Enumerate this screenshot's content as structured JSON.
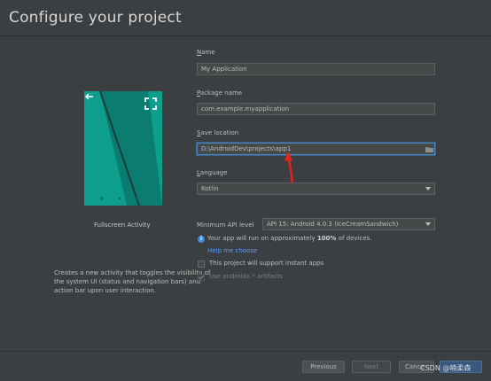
{
  "header": {
    "title": "Configure your project"
  },
  "preview": {
    "template_name": "Fullscreen Activity",
    "description": "Creates a new activity that toggles the visibility of the system UI (status and navigation bars) and action bar upon user interaction.",
    "phone_color": "#0e9e8d",
    "icons": [
      "back-arrow-icon",
      "fullscreen-icon"
    ]
  },
  "form": {
    "name": {
      "label_key": "N",
      "label_rest": "ame",
      "value": "My Application"
    },
    "package": {
      "label_key": "P",
      "label_rest": "ackage name",
      "value": "com.example.myapplication"
    },
    "save_location": {
      "label_key": "S",
      "label_rest": "ave location",
      "value": "D:\\AndroidDev\\projects\\app1"
    },
    "language": {
      "label_key": "L",
      "label_rest": "anguage",
      "value": "Kotlin"
    },
    "min_api": {
      "label": "Minimum API level",
      "value": "API 15: Android 4.0.3 (IceCreamSandwich)"
    }
  },
  "info": {
    "prefix": "Your app will run on approximately ",
    "percent": "100%",
    "suffix": " of devices.",
    "help_link": "Help me choose"
  },
  "options": {
    "instant_apps": {
      "label": "This project will support instant apps",
      "checked": false
    },
    "androidx": {
      "label": "Use androidx.* artifacts",
      "checked": true,
      "disabled": true
    }
  },
  "footer": {
    "previous": "Previous",
    "next": "Next",
    "cancel": "Cance",
    "watermark": "CSDN @喃柔森"
  },
  "colors": {
    "accent": "#4a88c7",
    "link": "#589df6",
    "annotation_arrow": "#e8211b"
  }
}
